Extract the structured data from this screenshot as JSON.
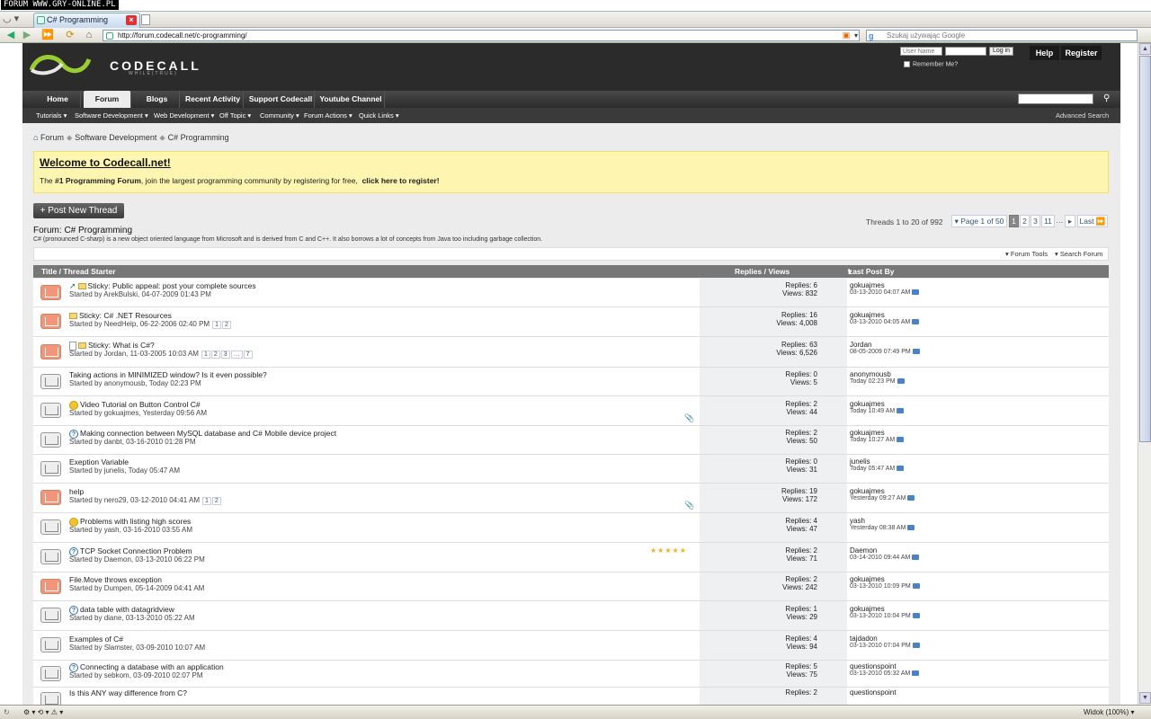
{
  "watermark": "FORUM WWW.GRY-ONLINE.PL",
  "browser": {
    "tab_title": "C# Programming",
    "address": "http://forum.codecall.net/c-programming/",
    "search_placeholder": "Szukaj używając Google",
    "status_zoom": "Widok (100%)"
  },
  "site": {
    "brand": "CODECALL",
    "tagline": "WHILE(TRUE)",
    "login": {
      "username_placeholder": "User Name",
      "login_btn": "Log in",
      "remember": "Remember Me?"
    },
    "help": "Help",
    "register": "Register",
    "nav": [
      "Home",
      "Forum",
      "Blogs",
      "Recent Activity",
      "Support Codecall",
      "Youtube Channel"
    ],
    "subnav": [
      "Tutorials",
      "Software Development",
      "Web Development",
      "Off Topic",
      "Community",
      "Forum Actions",
      "Quick Links"
    ],
    "advanced_search": "Advanced Search"
  },
  "breadcrumb": [
    "Forum",
    "Software Development",
    "C# Programming"
  ],
  "welcome": {
    "title": "Welcome to Codecall.net!",
    "pre": "The ",
    "bold": "#1 Programming Forum",
    "mid": ", join the largest programming community by registering for free,",
    "link": "click here to register!"
  },
  "post_new_thread": "+ Post New Thread",
  "forum": {
    "title": "Forum: C# Programming",
    "description": "C# (pronounced C-sharp) is a new object oriented language from Microsoft and is derived from C and C++. It also borrows a lot of concepts from Java too including garbage collection."
  },
  "pagination": {
    "threads_info": "Threads 1 to 20 of 992",
    "page_of": "Page 1 of 50",
    "pages": [
      "1",
      "2",
      "3",
      "11"
    ],
    "ellipsis": "…",
    "last": "Last"
  },
  "tools": {
    "forum_tools": "Forum Tools",
    "search_forum": "Search Forum"
  },
  "columns": {
    "title": "Title / Thread Starter",
    "replies": "Replies / Views",
    "last_post": "Last Post By"
  },
  "threads": [
    {
      "title": "Sticky: Public appeal: post your complete sources",
      "starter": "Started by ArekBulski, 04-07-2009 01:43 PM",
      "replies": "Replies: 6",
      "views": "Views: 832",
      "last_user": "gokuajmes",
      "last_date": "03-13-2010 04:07 AM"
    },
    {
      "title": "Sticky: C# .NET Resources",
      "starter": "Started by NeedHelp, 06-22-2006 02:40 PM",
      "pages": [
        "1",
        "2"
      ],
      "replies": "Replies: 16",
      "views": "Views: 4,008",
      "last_user": "gokuajmes",
      "last_date": "03-13-2010 04:05 AM"
    },
    {
      "title": "Sticky: What is C#?",
      "starter": "Started by Jordan, 11-03-2005 10:03 AM",
      "pages": [
        "1",
        "2",
        "3",
        "…",
        "7"
      ],
      "replies": "Replies: 63",
      "views": "Views: 6,526",
      "last_user": "Jordan",
      "last_date": "08-05-2009 07:49 PM"
    },
    {
      "title": "Taking actions in MINIMIZED window? Is it even possible?",
      "starter": "Started by anonymousb, Today 02:23 PM",
      "replies": "Replies: 0",
      "views": "Views: 5",
      "last_user": "anonymousb",
      "last_date": "Today 02:23 PM"
    },
    {
      "title": "Video Tutorial on Button Control C#",
      "starter": "Started by gokuajmes, Yesterday 09:56 AM",
      "replies": "Replies: 2",
      "views": "Views: 44",
      "last_user": "gokuajmes",
      "last_date": "Today 10:49 AM"
    },
    {
      "title": "Making connection between MySQL database and C# Mobile device project",
      "starter": "Started by danbt, 03-16-2010 01:28 PM",
      "replies": "Replies: 2",
      "views": "Views: 50",
      "last_user": "gokuajmes",
      "last_date": "Today 10:27 AM"
    },
    {
      "title": "Exeption Variable",
      "starter": "Started by junelis, Today 05:47 AM",
      "replies": "Replies: 0",
      "views": "Views: 31",
      "last_user": "junelis",
      "last_date": "Today 05:47 AM"
    },
    {
      "title": "help",
      "starter": "Started by nero29, 03-12-2010 04:41 AM",
      "pages": [
        "1",
        "2"
      ],
      "replies": "Replies: 19",
      "views": "Views: 172",
      "last_user": "gokuajmes",
      "last_date": "Yesterday 09:27 AM"
    },
    {
      "title": "Problems with listing high scores",
      "starter": "Started by yash, 03-16-2010 03:55 AM",
      "replies": "Replies: 4",
      "views": "Views: 47",
      "last_user": "yash",
      "last_date": "Yesterday 08:38 AM"
    },
    {
      "title": "TCP Socket Connection Problem",
      "starter": "Started by Daemon, 03-13-2010 06:22 PM",
      "replies": "Replies: 2",
      "views": "Views: 71",
      "last_user": "Daemon",
      "last_date": "03-14-2010 09:44 AM"
    },
    {
      "title": "File.Move throws exception",
      "starter": "Started by Dumpen, 05-14-2009 04:41 AM",
      "replies": "Replies: 2",
      "views": "Views: 242",
      "last_user": "gokuajmes",
      "last_date": "03-13-2010 10:09 PM"
    },
    {
      "title": "data table with datagridview",
      "starter": "Started by diane, 03-13-2010 05:22 AM",
      "replies": "Replies: 1",
      "views": "Views: 29",
      "last_user": "gokuajmes",
      "last_date": "03-13-2010 10:04 PM"
    },
    {
      "title": "Examples of C#",
      "starter": "Started by Slamster, 03-09-2010 10:07 AM",
      "replies": "Replies: 4",
      "views": "Views: 94",
      "last_user": "tajdadon",
      "last_date": "03-13-2010 07:04 PM"
    },
    {
      "title": "Connecting a database with an application",
      "starter": "Started by sebkom, 03-09-2010 02:07 PM",
      "replies": "Replies: 5",
      "views": "Views: 75",
      "last_user": "questionspoint",
      "last_date": "03-13-2010 05:32 AM"
    },
    {
      "title": "Is this ANY way difference from C?",
      "starter": "",
      "replies": "Replies: 2",
      "views": "",
      "last_user": "questionspoint",
      "last_date": ""
    }
  ],
  "colors": {
    "header_bg": "#2b2b2b",
    "welcome_bg": "#fef6b0",
    "thead_bg": "#777777",
    "unread_icon": "#f2957a"
  }
}
